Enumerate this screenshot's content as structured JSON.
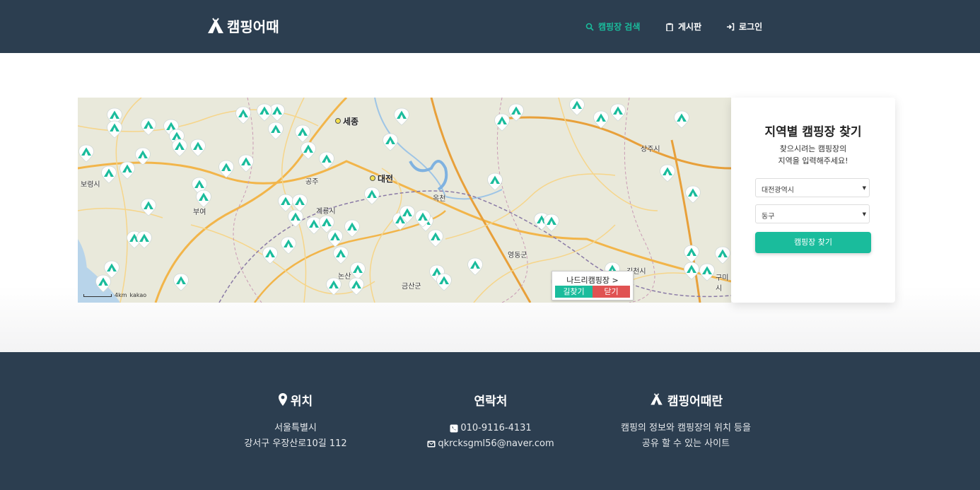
{
  "header": {
    "logo_text": "캠핑어때",
    "nav": [
      {
        "label": "캠핑장 검색",
        "icon": "search-icon",
        "active": true
      },
      {
        "label": "게시판",
        "icon": "clipboard-icon",
        "active": false
      },
      {
        "label": "로그인",
        "icon": "sign-in-icon",
        "active": false
      }
    ]
  },
  "map": {
    "labels": {
      "sejong": "세종",
      "daejeon": "대전",
      "boryeong": "보령시",
      "buyeo": "부여",
      "gyeryong": "계룡시",
      "gongju": "공주",
      "okcheon": "옥천",
      "yeongdong": "영동군",
      "geumsan": "금산군",
      "sangju": "상주시",
      "gimcheon": "김천시",
      "nonsan": "논산",
      "gumi": "구미시"
    },
    "popup": {
      "title": "나드리캠핑장 >",
      "go_label": "길찾기",
      "close_label": "닫기"
    },
    "attribution": "kakao",
    "scale_text": "4km"
  },
  "search": {
    "title": "지역별 캠핑장 찾기",
    "desc_line1": "찾으시려는 캠핑장의",
    "desc_line2": "지역을 입력해주세요!",
    "region_value": "대전광역시",
    "district_value": "동구",
    "button_label": "캠핑장 찾기"
  },
  "footer": {
    "location": {
      "title": "위치",
      "line1": "서울특별시",
      "line2": "강서구 우장산로10길 112"
    },
    "contact": {
      "title": "연락처",
      "phone": "010-9116-4131",
      "email": "qkrcksgml56@naver.com"
    },
    "about": {
      "title": "캠핑어때란",
      "line1": "캠핑의 정보와 캠핑장의 위치 등을",
      "line2": "공유 할 수 있는 사이트"
    }
  },
  "colors": {
    "header_bg": "#2c3e50",
    "accent": "#1abc9c",
    "danger": "#e05252"
  }
}
